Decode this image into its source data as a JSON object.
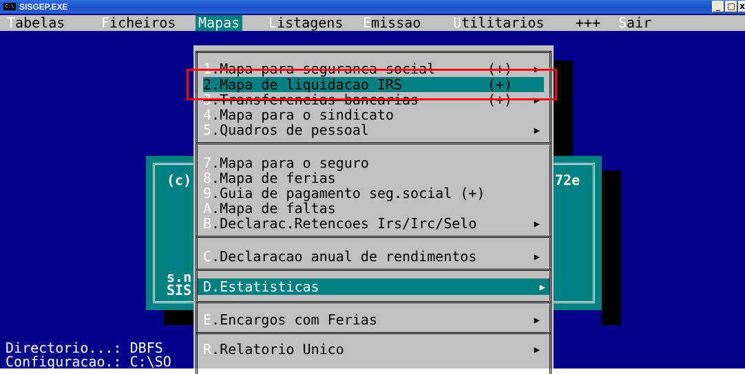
{
  "window": {
    "title": "SISGEP.EXE",
    "icon_text": "C:\\",
    "buttons": [
      "_",
      "□",
      "x"
    ]
  },
  "menubar": [
    {
      "hot": "T",
      "rest": "abelas"
    },
    {
      "hot": "F",
      "rest": "icheiros"
    },
    {
      "hot": "",
      "rest": "Mapas"
    },
    {
      "hot": "L",
      "rest": "istagens"
    },
    {
      "hot": "E",
      "rest": "missao"
    },
    {
      "hot": "U",
      "rest": "tilitarios"
    },
    {
      "hot": "",
      "rest": "+++"
    },
    {
      "hot": "S",
      "rest": "air"
    }
  ],
  "mapas_menu": {
    "items": [
      {
        "key": "1",
        "label": ".Mapa para seguranca social",
        "mark": "(+)",
        "arrow": "▶"
      },
      {
        "key": "2",
        "label": ".Mapa de liquidacao IRS",
        "mark": "(+)",
        "arrow": ""
      },
      {
        "key": "3",
        "label": ".Transferencias bancarias",
        "mark": "(+)",
        "arrow": "▶"
      },
      {
        "key": "4",
        "label": ".Mapa para o sindicato",
        "mark": "",
        "arrow": ""
      },
      {
        "key": "5",
        "label": ".Quadros de pessoal",
        "mark": "",
        "arrow": "▶"
      },
      {
        "key": "7",
        "label": ".Mapa para o seguro",
        "mark": "",
        "arrow": ""
      },
      {
        "key": "8",
        "label": ".Mapa de ferias",
        "mark": "",
        "arrow": ""
      },
      {
        "key": "9",
        "label": ".Guia de pagamento seg.social (+)",
        "mark": "",
        "arrow": ""
      },
      {
        "key": "A",
        "label": ".Mapa de faltas",
        "mark": "",
        "arrow": ""
      },
      {
        "key": "B",
        "label": ".Declarac.Retencoes Irs/Irc/Selo",
        "mark": "",
        "arrow": "▶"
      },
      {
        "key": "C",
        "label": ".Declaracao anual de rendimentos",
        "mark": "",
        "arrow": "▶"
      },
      {
        "key": "D",
        "label": ".Estatisticas",
        "mark": "",
        "arrow": "▶"
      },
      {
        "key": "E",
        "label": ".Encargos com Ferias",
        "mark": "",
        "arrow": "▶"
      },
      {
        "key": "R",
        "label": ".Relatorio Unico",
        "mark": "",
        "arrow": "▶"
      }
    ]
  },
  "background_box": {
    "copyright": "(c)",
    "version_frag": "72e",
    "line1": "s.n",
    "line2": "SIS"
  },
  "status": {
    "directorio": "Directorio...: DBFS",
    "configuracao": "Configuracao.: C:\\SO"
  },
  "colors": {
    "console_bg": "#000088",
    "menu_bg": "#c0c0c0",
    "highlight": "#008080",
    "annotation": "#ff0000"
  }
}
